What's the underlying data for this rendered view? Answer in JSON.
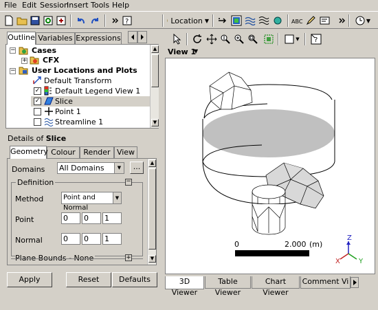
{
  "menu": [
    "File",
    "Edit",
    "Session",
    "Insert",
    "Tools",
    "Help"
  ],
  "toolbar": {
    "location_label": "Location"
  },
  "left_tabs": [
    "Outline",
    "Variables",
    "Expressions"
  ],
  "tree": {
    "cases": "Cases",
    "cfx": "CFX",
    "user_locations": "User Locations and Plots",
    "items": [
      "Default Transform",
      "Default Legend View 1",
      "Slice",
      "Point 1",
      "Streamline 1"
    ]
  },
  "details": {
    "title_prefix": "Details of",
    "title_object": "Slice",
    "tabs": [
      "Geometry",
      "Colour",
      "Render",
      "View"
    ],
    "domains_label": "Domains",
    "domains_value": "All Domains",
    "ellipsis": "...",
    "definition_label": "Definition",
    "method_label": "Method",
    "method_value": "Point and Normal",
    "point_label": "Point",
    "point": [
      "0",
      "0",
      "1"
    ],
    "normal_label": "Normal",
    "normal": [
      "0",
      "0",
      "1"
    ],
    "plane_bounds": "Plane Bounds - None"
  },
  "buttons": {
    "apply": "Apply",
    "reset": "Reset",
    "defaults": "Defaults"
  },
  "view": {
    "title": "View 1",
    "scale_left": "0",
    "scale_right": "2.000",
    "scale_unit": "(m)",
    "axis_z": "Z",
    "axis_x": "X",
    "axis_y": "Y"
  },
  "bottom_tabs": [
    "3D Viewer",
    "Table Viewer",
    "Chart Viewer",
    "Comment Vi"
  ],
  "colors": {
    "highlight": "#0a246a",
    "selected_row": "#d4d0c8"
  }
}
